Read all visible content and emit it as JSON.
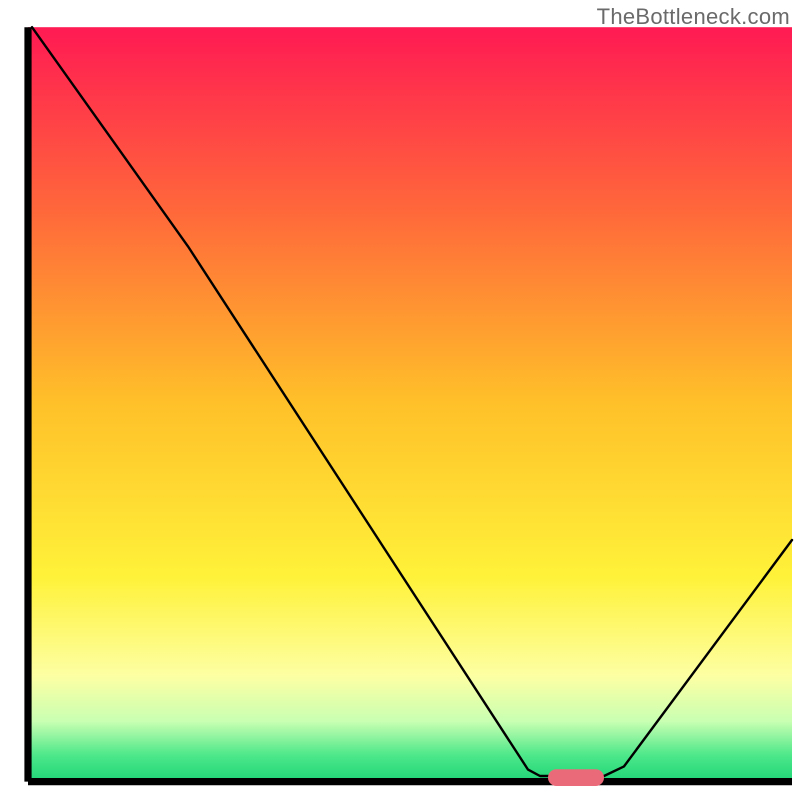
{
  "watermark": "TheBottleneck.com",
  "chart_data": {
    "type": "line",
    "title": "",
    "xlabel": "",
    "ylabel": "",
    "xlim": [
      0,
      100
    ],
    "ylim": [
      0,
      100
    ],
    "grid": false,
    "background": {
      "type": "vertical_gradient",
      "stops": [
        {
          "offset": 0.0,
          "color": "#ff1a53"
        },
        {
          "offset": 0.25,
          "color": "#ff6a3a"
        },
        {
          "offset": 0.5,
          "color": "#ffc129"
        },
        {
          "offset": 0.73,
          "color": "#fff23a"
        },
        {
          "offset": 0.86,
          "color": "#fdffa3"
        },
        {
          "offset": 0.92,
          "color": "#c9ffb2"
        },
        {
          "offset": 0.965,
          "color": "#4de88a"
        },
        {
          "offset": 1.0,
          "color": "#1fd577"
        }
      ]
    },
    "axes": {
      "left": {
        "x": 3.5,
        "y0": 3.4,
        "y1": 97.7,
        "width": 0.9
      },
      "bottom": {
        "y": 97.7,
        "x0": 3.5,
        "x1": 99.0,
        "width": 0.9
      }
    },
    "series": [
      {
        "name": "bottleneck-curve",
        "color": "#000000",
        "stroke_width": 2.4,
        "points": [
          {
            "x": 4.0,
            "y": 3.4
          },
          {
            "x": 23.5,
            "y": 30.8
          },
          {
            "x": 66.0,
            "y": 96.2
          },
          {
            "x": 67.5,
            "y": 97.0
          },
          {
            "x": 75.5,
            "y": 97.0
          },
          {
            "x": 78.0,
            "y": 95.8
          },
          {
            "x": 99.0,
            "y": 67.5
          }
        ]
      }
    ],
    "optimal_marker": {
      "shape": "capsule",
      "x_center": 72.0,
      "y": 97.2,
      "width": 7.0,
      "height": 2.1,
      "fill": "#ea6a7a"
    }
  }
}
